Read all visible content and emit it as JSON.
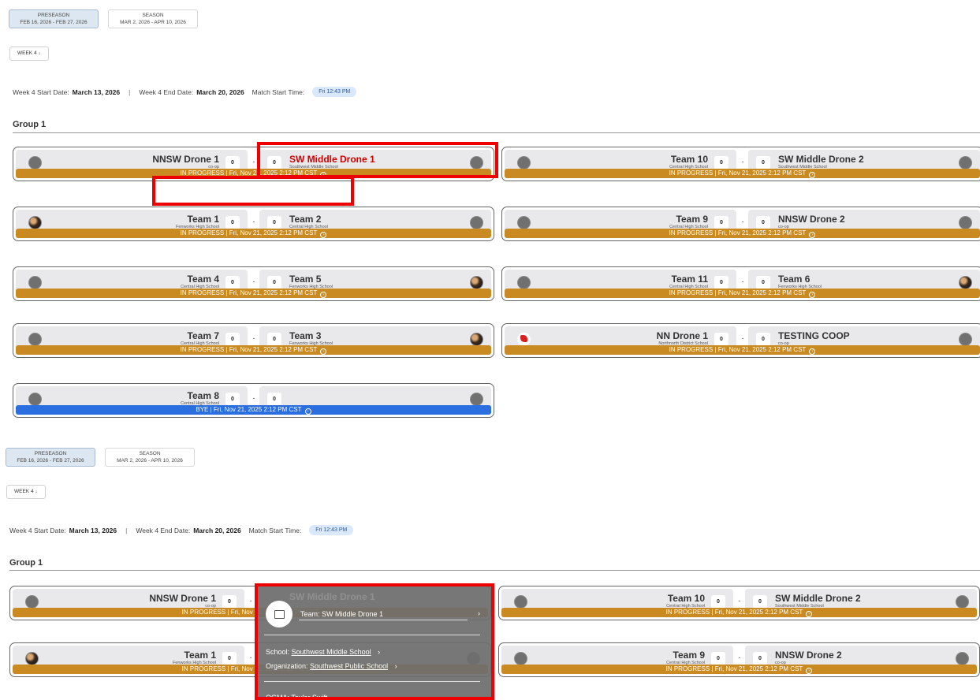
{
  "season_tabs": [
    {
      "name": "PRESEASON",
      "dates": "FEB 16, 2026 - FEB 27, 2026"
    },
    {
      "name": "SEASON",
      "dates": "MAR 2, 2026 - APR 10, 2026"
    }
  ],
  "week_button": "WEEK 4 ↓",
  "dates_line": {
    "start_label": "Week 4 Start Date:",
    "start_value": "March 13, 2026",
    "separator": "|",
    "end_label": "Week 4 End Date:",
    "end_value": "March 20, 2026",
    "match_start_label": "Match Start Time:",
    "match_start_value": "Fri 12:43 PM"
  },
  "group_title": "Group 1",
  "status_in_progress": "IN PROGRESS | Fri, Nov 21, 2025 2:12 PM CST",
  "status_bye": "BYE | Fri, Nov 21, 2025 2:12 PM CST",
  "matches": [
    {
      "left": {
        "name": "NNSW Drone 1",
        "school": "co-op",
        "score": "0"
      },
      "right": {
        "name": "SW Middle Drone 1",
        "school": "Southwest Middle School",
        "score": "0"
      }
    },
    {
      "left": {
        "name": "Team 10",
        "school": "Central High School",
        "score": "0"
      },
      "right": {
        "name": "SW Middle Drone 2",
        "school": "Southwest Middle School",
        "score": "0"
      }
    },
    {
      "left": {
        "name": "Team 1",
        "school": "Fenworks High School",
        "score": "0"
      },
      "right": {
        "name": "Team 2",
        "school": "Central High School",
        "score": "0"
      }
    },
    {
      "left": {
        "name": "Team 9",
        "school": "Central High School",
        "score": "0"
      },
      "right": {
        "name": "NNSW Drone 2",
        "school": "co-op",
        "score": "0"
      }
    },
    {
      "left": {
        "name": "Team 4",
        "school": "Central High School",
        "score": "0"
      },
      "right": {
        "name": "Team 5",
        "school": "Fenworks High School",
        "score": "0"
      }
    },
    {
      "left": {
        "name": "Team 11",
        "school": "Central High School",
        "score": "0"
      },
      "right": {
        "name": "Team 6",
        "school": "Fenworks High School",
        "score": "0"
      }
    },
    {
      "left": {
        "name": "Team 7",
        "school": "Central High School",
        "score": "0"
      },
      "right": {
        "name": "Team 3",
        "school": "Fenworks High School",
        "score": "0"
      }
    },
    {
      "left": {
        "name": "NN Drone 1",
        "school": "Northnorth District School",
        "score": "0"
      },
      "right": {
        "name": "TESTING COOP",
        "school": "co-op",
        "score": "0"
      }
    },
    {
      "left": {
        "name": "Team 8",
        "school": "Central High School",
        "score": "0"
      },
      "right": {
        "name": "",
        "school": "",
        "score": "0"
      }
    }
  ],
  "popup": {
    "team_label": "Team:",
    "team_value": "SW Middle Drone 1",
    "school_label": "School:",
    "school_value": "Southwest Middle School",
    "org_label": "Organization:",
    "org_value": "Southwest Public School",
    "ogma_text": "OGMA: Taylor Swift",
    "ghost_text": "SW Middle Drone 1",
    "chevron": "›"
  }
}
